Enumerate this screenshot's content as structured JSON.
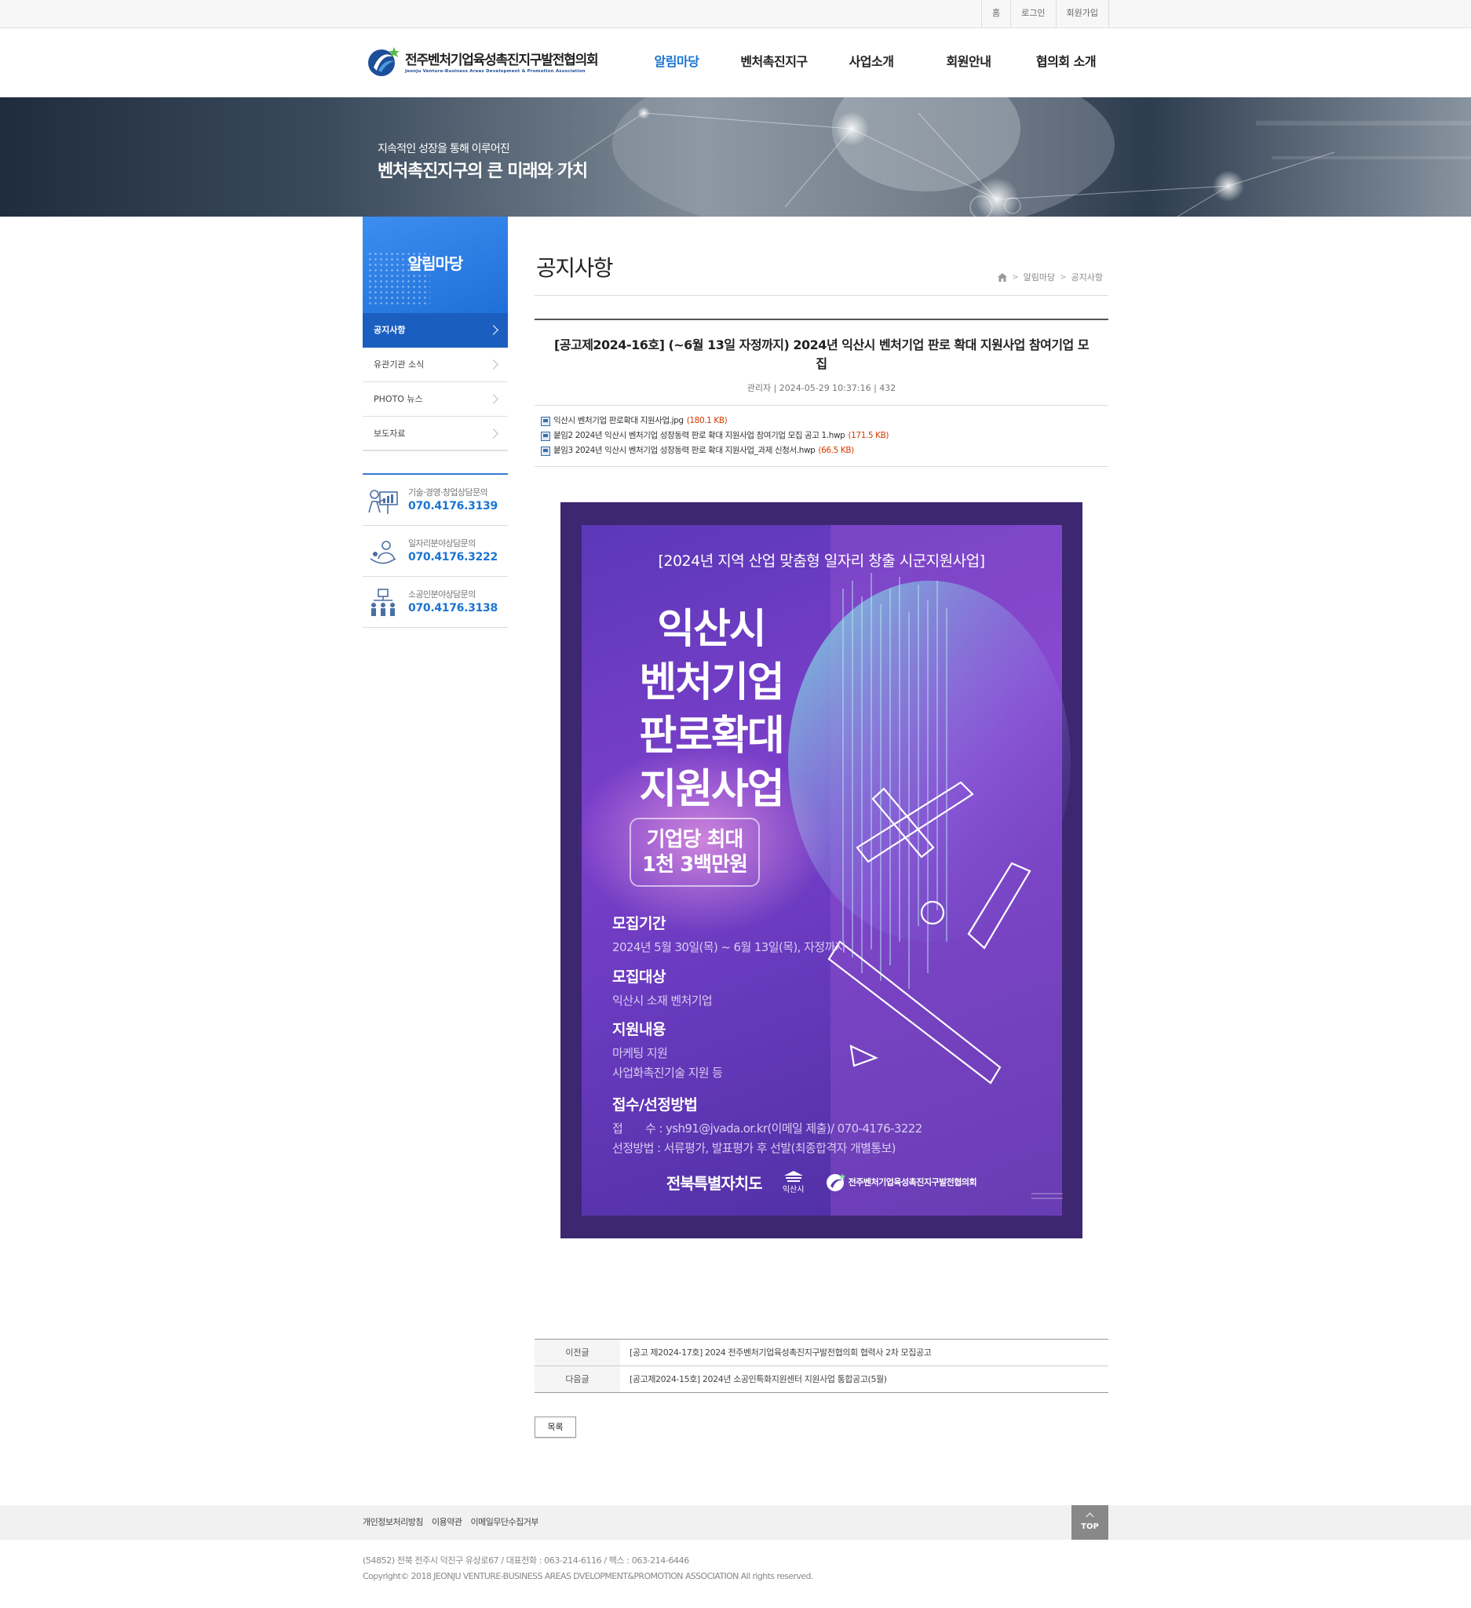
{
  "util": {
    "home": "홈",
    "login": "로그인",
    "join": "회원가입"
  },
  "header": {
    "logo_title": "전주벤처기업육성촉진지구발전협의회",
    "logo_sub": "Jeonju Venture-Business Areas Development & Promotion Association",
    "nav": [
      "알림마당",
      "벤처촉진지구",
      "사업소개",
      "회원안내",
      "협의회 소개"
    ]
  },
  "hero": {
    "subtitle": "지속적인 성장을 통해 이루어진",
    "title": "벤처촉진지구의 큰 미래와 가치"
  },
  "sidebar": {
    "title": "알림마당",
    "items": [
      {
        "label": "공지사항",
        "active": true
      },
      {
        "label": "유관기관 소식"
      },
      {
        "label": "PHOTO 뉴스"
      },
      {
        "label": "보도자료"
      }
    ],
    "contacts": [
      {
        "label": "기술·경영·창업상담문의",
        "number": "070.4176.3139",
        "icon": "consulting-icon"
      },
      {
        "label": "일자리분야상담문의",
        "number": "070.4176.3222",
        "icon": "job-icon"
      },
      {
        "label": "소공인분야상담문의",
        "number": "070.4176.3138",
        "icon": "small-business-icon"
      }
    ]
  },
  "content": {
    "page_title": "공지사항",
    "breadcrumb": [
      "알림마당",
      "공지사항"
    ],
    "post_title": "[공고제2024-16호] (~6월 13일 자정까지) 2024년 익산시 벤처기업 판로 확대 지원사업 참여기업 모집",
    "post_meta": "관리자 | 2024-05-29 10:37:16 | 432",
    "files": [
      {
        "name": "익산시 벤처기업 판로확대 지원사업.jpg",
        "size": "(180.1 KB)"
      },
      {
        "name": "붙임2 2024년 익산시 벤처기업 성장동력 판로 확대 지원사업 참여기업 모집 공고 1.hwp",
        "size": "(171.5 KB)"
      },
      {
        "name": "붙임3 2024년 익산시 벤처기업 성장동력 판로 확대 지원사업_과제 신청서.hwp",
        "size": "(66.5 KB)"
      }
    ]
  },
  "poster": {
    "header": "[2024년 지역 산업 맞춤형 일자리 창출 시군지원사업]",
    "big_lines": [
      "익산시",
      "벤처기업",
      "판로확대",
      "지원사업"
    ],
    "badge_lines": [
      "기업당 최대",
      "1천 3백만원"
    ],
    "sections": [
      {
        "title": "모집기간",
        "lines": [
          "2024년 5월 30일(목) ~ 6월 13일(목), 자정까지"
        ]
      },
      {
        "title": "모집대상",
        "lines": [
          "익산시 소재 벤처기업"
        ]
      },
      {
        "title": "지원내용",
        "lines": [
          "마케팅 지원",
          "사업화촉진기술 지원 등"
        ]
      },
      {
        "title": "접수/선정방법",
        "lines": [
          "접　　수 : ysh91@jvada.or.kr(이메일 제출)/ 070-4176-3222",
          "선정방법 : 서류평가, 발표평가 후 선발(최종합격자 개별통보)"
        ]
      }
    ],
    "footer": {
      "org1": "전북특별자치도",
      "org2": "익산시",
      "org3": "전주벤처기업육성촉진지구발전협의회"
    }
  },
  "prev_next": {
    "prev_label": "이전글",
    "prev_title": "[공고 제2024-17호] 2024 전주벤처기업육성촉진지구발전협의회 협력사 2차 모집공고",
    "next_label": "다음글",
    "next_title": "[공고제2024-15호] 2024년 소공인특화지원센터 지원사업 통합공고(5월)"
  },
  "list_button": "목록",
  "footer": {
    "links": [
      "개인정보처리방침",
      "이용약관",
      "이메일무단수집거부"
    ],
    "top": "TOP",
    "address": "(54852) 전북 전주시 덕진구 유상로67 / 대표전화 : 063-214-6116 / 팩스 : 063-214-6446",
    "copyright": "Copyright© 2018 JEONJU VENTURE-BUSINESS AREAS DVELOPMENT&PROMOTION ASSOCIATION All rights reserved."
  },
  "colors": {
    "accent": "#1b74d1",
    "sidebar_active": "#1a5fc0",
    "poster_bg": "#3d2770"
  }
}
